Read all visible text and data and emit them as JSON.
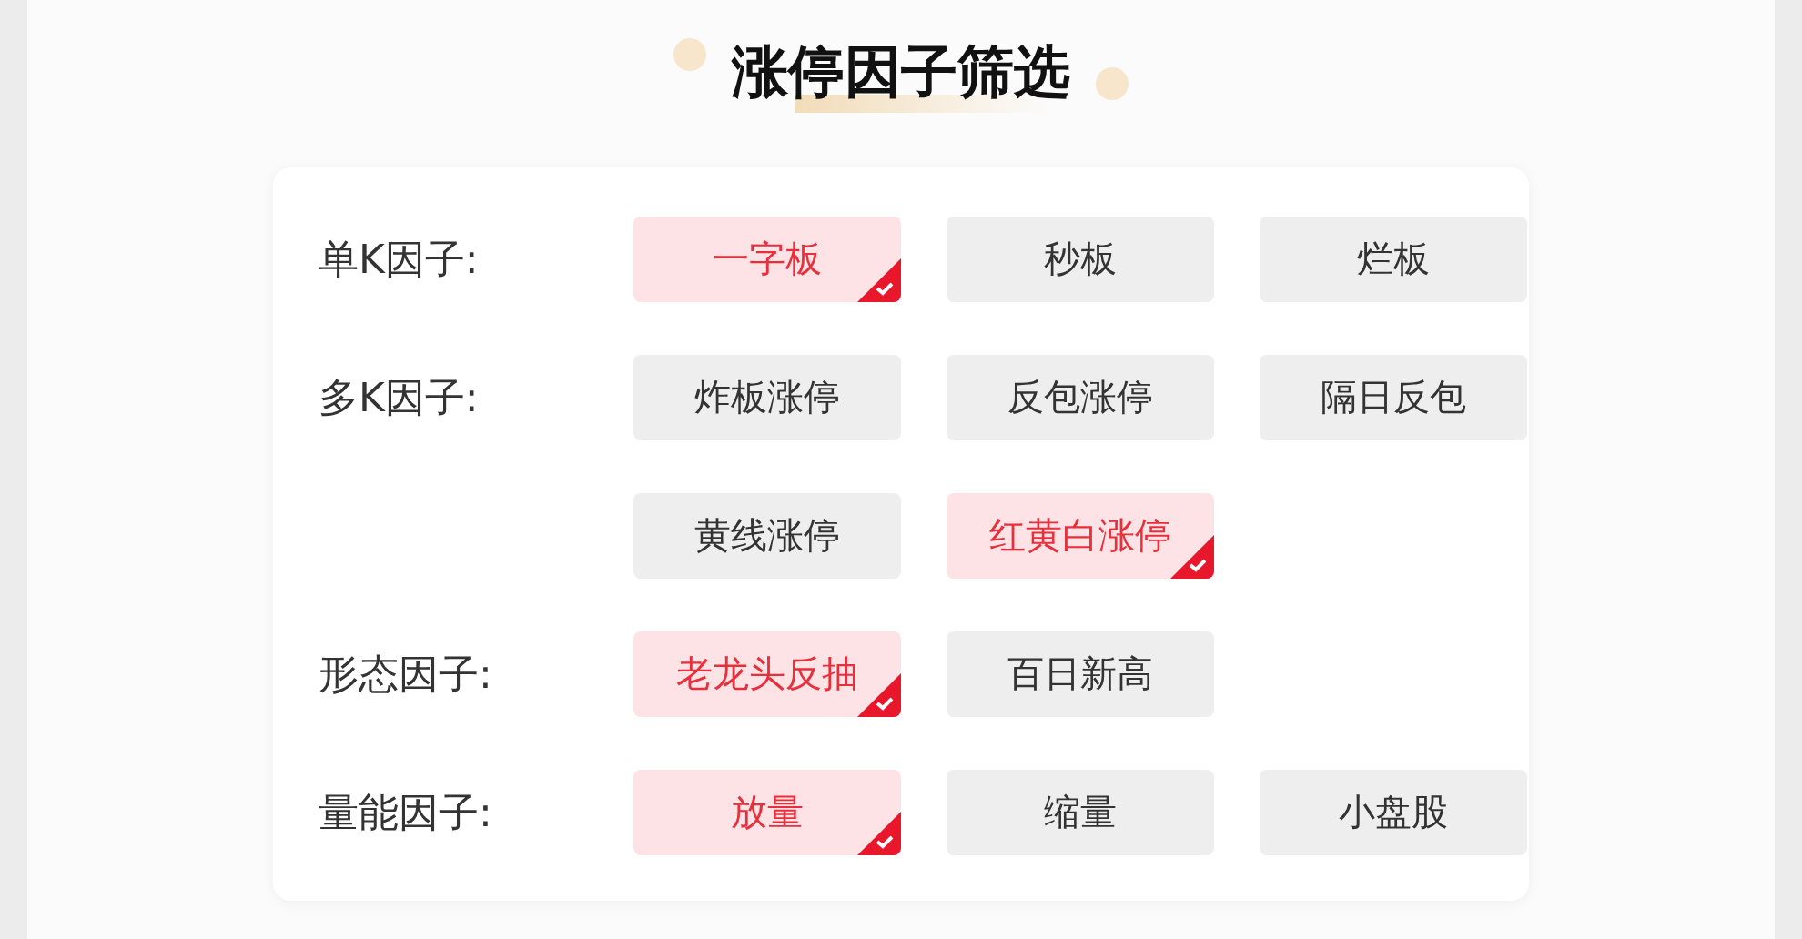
{
  "title": "涨停因子筛选",
  "groups": [
    {
      "label": "单K因子:",
      "options": [
        {
          "label": "一字板",
          "selected": true
        },
        {
          "label": "秒板",
          "selected": false
        },
        {
          "label": "烂板",
          "selected": false
        }
      ]
    },
    {
      "label": "多K因子:",
      "options": [
        {
          "label": "炸板涨停",
          "selected": false
        },
        {
          "label": "反包涨停",
          "selected": false
        },
        {
          "label": "隔日反包",
          "selected": false
        },
        {
          "label": "黄线涨停",
          "selected": false
        },
        {
          "label": "红黄白涨停",
          "selected": true
        }
      ]
    },
    {
      "label": "形态因子:",
      "options": [
        {
          "label": "老龙头反抽",
          "selected": true
        },
        {
          "label": "百日新高",
          "selected": false
        }
      ]
    },
    {
      "label": "量能因子:",
      "options": [
        {
          "label": "放量",
          "selected": true
        },
        {
          "label": "缩量",
          "selected": false
        },
        {
          "label": "小盘股",
          "selected": false
        }
      ]
    }
  ]
}
